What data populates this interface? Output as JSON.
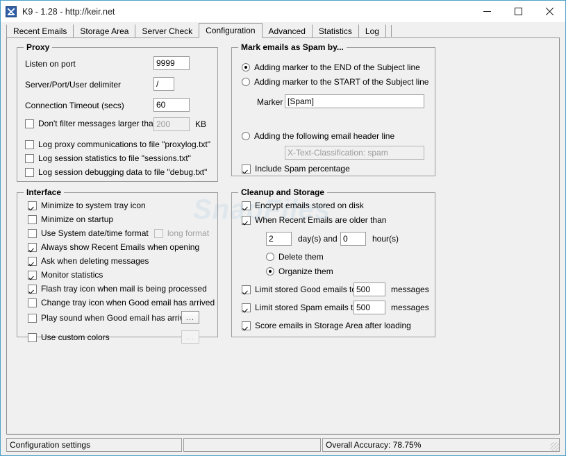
{
  "window": {
    "title": "K9 - 1.28 - http://keir.net",
    "icon": "k9-app-icon",
    "minimize_label": "–",
    "maximize_label": "□",
    "close_label": "✕"
  },
  "watermark": "SnapFiles",
  "tabs": [
    {
      "label": "Recent Emails",
      "active": false
    },
    {
      "label": "Storage Area",
      "active": false
    },
    {
      "label": "Server Check",
      "active": false
    },
    {
      "label": "Configuration",
      "active": true
    },
    {
      "label": "Advanced",
      "active": false
    },
    {
      "label": "Statistics",
      "active": false
    },
    {
      "label": "Log",
      "active": false
    }
  ],
  "proxy": {
    "legend": "Proxy",
    "listen_port_label": "Listen on port",
    "listen_port_value": "9999",
    "delimiter_label": "Server/Port/User delimiter",
    "delimiter_value": "/",
    "timeout_label": "Connection Timeout (secs)",
    "timeout_value": "60",
    "dont_filter_label": "Don't filter messages larger than",
    "dont_filter_checked": false,
    "dont_filter_value": "200",
    "dont_filter_unit": "KB",
    "log_proxy_label": "Log proxy communications to file \"proxylog.txt\"",
    "log_proxy_checked": false,
    "log_session_label": "Log session statistics to file \"sessions.txt\"",
    "log_session_checked": false,
    "log_debug_label": "Log session debugging data to file \"debug.txt\"",
    "log_debug_checked": false
  },
  "interface": {
    "legend": "Interface",
    "items": [
      {
        "label": "Minimize to system tray icon",
        "checked": true
      },
      {
        "label": "Minimize on startup",
        "checked": false
      },
      {
        "label": "Use System date/time format",
        "checked": false
      },
      {
        "label": "Always show Recent Emails when opening",
        "checked": true
      },
      {
        "label": "Ask when deleting messages",
        "checked": true
      },
      {
        "label": "Monitor statistics",
        "checked": true
      },
      {
        "label": "Flash tray icon when mail is being processed",
        "checked": true
      },
      {
        "label": "Change tray icon when Good email has arrived",
        "checked": false
      },
      {
        "label": "Play sound when Good email has arrived",
        "checked": false
      },
      {
        "label": "Use custom colors",
        "checked": false
      }
    ],
    "long_format_label": "long format",
    "long_format_checked": false,
    "long_format_enabled": false,
    "browse_sound_label": "...",
    "browse_colors_label": "..."
  },
  "spam_marking": {
    "legend": "Mark emails as Spam by...",
    "option_end_label": "Adding marker to the END of the Subject line",
    "option_start_label": "Adding marker to the START of the Subject line",
    "option_header_label": "Adding the following email header line",
    "selected_option": "end",
    "marker_label": "Marker",
    "marker_value": "[Spam]",
    "header_value": "X-Text-Classification: spam",
    "header_enabled": false,
    "include_percentage_label": "Include Spam percentage",
    "include_percentage_checked": true
  },
  "cleanup": {
    "legend": "Cleanup and Storage",
    "encrypt_label": "Encrypt emails stored on disk",
    "encrypt_checked": true,
    "older_than_label": "When Recent Emails are older than",
    "older_than_checked": true,
    "days_value": "2",
    "days_label": "day(s) and",
    "hours_value": "0",
    "hours_label": "hour(s)",
    "delete_them_label": "Delete them",
    "organize_them_label": "Organize them",
    "selected_action": "organize",
    "limit_good_label": "Limit stored Good emails to",
    "limit_good_checked": true,
    "limit_good_value": "500",
    "limit_good_unit": "messages",
    "limit_spam_label": "Limit stored Spam emails to",
    "limit_spam_checked": true,
    "limit_spam_value": "500",
    "limit_spam_unit": "messages",
    "score_label": "Score emails in Storage Area after loading",
    "score_checked": true
  },
  "statusbar": {
    "left": "Configuration settings",
    "middle": "",
    "right": "Overall Accuracy: 78.75%"
  }
}
